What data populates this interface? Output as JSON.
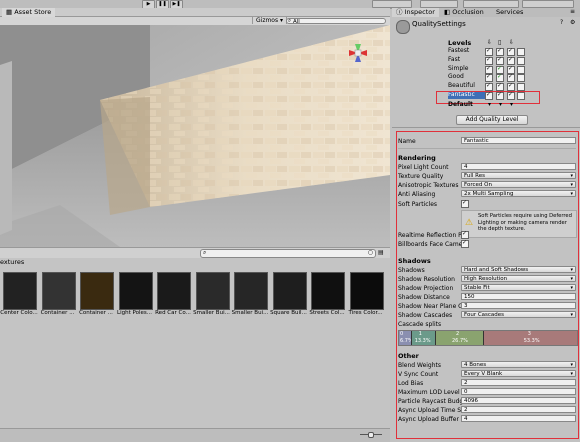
{
  "scene_tab": "Asset Store",
  "scene_toolbar": {
    "gizmos": "Gizmos",
    "search_prefix": "All"
  },
  "inspector_tabs": [
    "Inspector",
    "Occlusion",
    "Services"
  ],
  "quality": {
    "title": "QualitySettings",
    "levels_header": "Levels",
    "levels": [
      "Fastest",
      "Fast",
      "Simple",
      "Good",
      "Beautiful",
      "Fantastic"
    ],
    "default_label": "Default",
    "add_button": "Add Quality Level"
  },
  "settings": {
    "name_label": "Name",
    "name_value": "Fantastic",
    "rendering_header": "Rendering",
    "pixel_light_label": "Pixel Light Count",
    "pixel_light_value": "4",
    "texture_quality_label": "Texture Quality",
    "texture_quality_value": "Full Res",
    "aniso_label": "Anisotropic Textures",
    "aniso_value": "Forced On",
    "aa_label": "Anti Aliasing",
    "aa_value": "2x Multi Sampling",
    "soft_particles_label": "Soft Particles",
    "soft_particles_warning": "Soft Particles require using Deferred Lighting or making camera render the depth texture.",
    "realtime_reflection_label": "Realtime Reflection Pr",
    "billboards_label": "Billboards Face Came",
    "shadows_header": "Shadows",
    "shadows_label": "Shadows",
    "shadows_value": "Hard and Soft Shadows",
    "shadow_res_label": "Shadow Resolution",
    "shadow_res_value": "High Resolution",
    "shadow_proj_label": "Shadow Projection",
    "shadow_proj_value": "Stable Fit",
    "shadow_dist_label": "Shadow Distance",
    "shadow_dist_value": "150",
    "shadow_near_label": "Shadow Near Plane O",
    "shadow_near_value": "3",
    "shadow_cascades_label": "Shadow Cascades",
    "shadow_cascades_value": "Four Cascades",
    "cascade_splits_label": "Cascade splits",
    "cascades": [
      {
        "index": "0",
        "pct": "6.7%"
      },
      {
        "index": "1",
        "pct": "13.3%"
      },
      {
        "index": "2",
        "pct": "26.7%"
      },
      {
        "index": "3",
        "pct": "53.3%"
      }
    ],
    "other_header": "Other",
    "blend_label": "Blend Weights",
    "blend_value": "4 Bones",
    "vsync_label": "V Sync Count",
    "vsync_value": "Every V Blank",
    "lod_bias_label": "Lod Bias",
    "lod_bias_value": "2",
    "max_lod_label": "Maximum LOD Level",
    "max_lod_value": "0",
    "particle_budget_label": "Particle Raycast Budg",
    "particle_budget_value": "4096",
    "async_time_label": "Async Upload Time Sl",
    "async_time_value": "2",
    "async_buffer_label": "Async Upload Buffer",
    "async_buffer_value": "4"
  },
  "project": {
    "folder": "extures",
    "items": [
      "Center Colo...",
      "Container ...",
      "Container ...",
      "Light Poles...",
      "Red Car Co...",
      "Smaller Bui...",
      "Smaller Bui...",
      "Square Buil...",
      "Streets Col...",
      "Tires Color..."
    ]
  },
  "colors": {
    "accent_red": "#e0303a",
    "cascade0": "#8a8fb0",
    "cascade1": "#6b9a8a",
    "cascade2": "#8aa36f",
    "cascade3": "#a87a7a"
  }
}
